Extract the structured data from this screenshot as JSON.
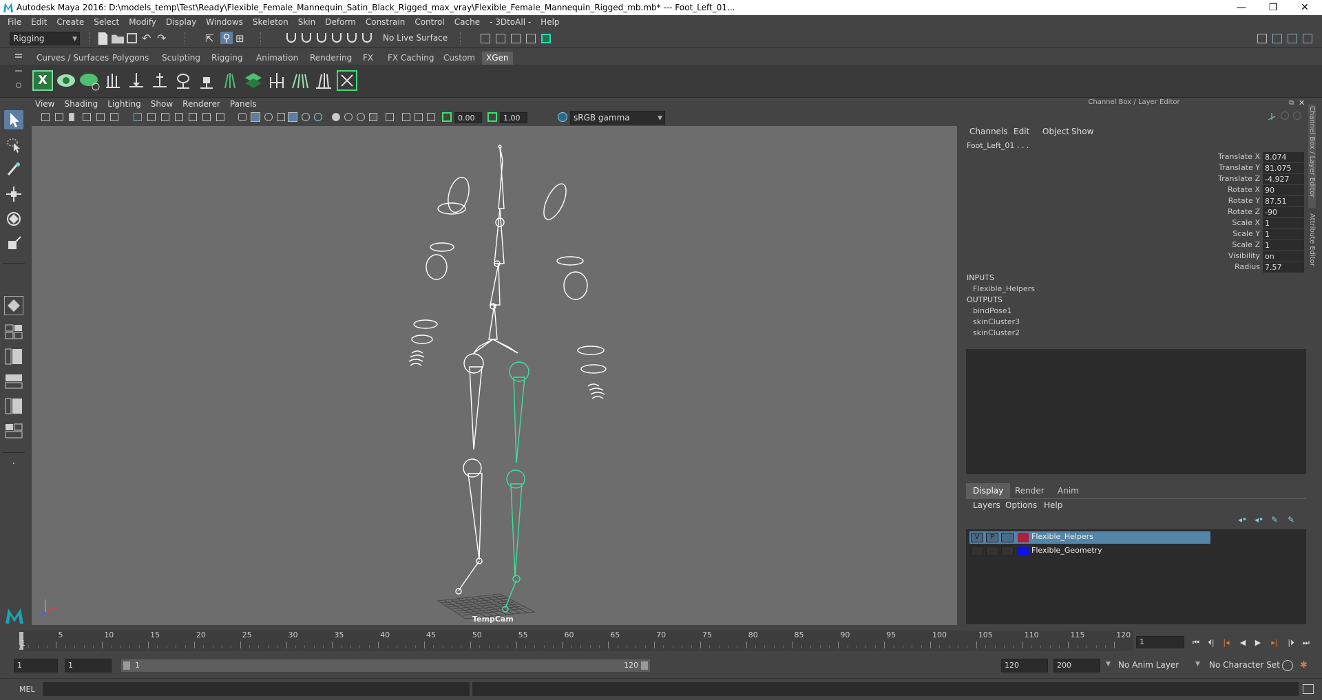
{
  "titlebar": {
    "title": "Autodesk Maya 2016: D:\\models_temp\\Test\\Ready\\Flexible_Female_Mannequin_Satin_Black_Rigged_max_vray\\Flexible_Female_Mannequin_Rigged_mb.mb*   ---   Foot_Left_01...",
    "minimize": "—",
    "maximize": "❐",
    "close": "✕"
  },
  "menubar": [
    "File",
    "Edit",
    "Create",
    "Select",
    "Modify",
    "Display",
    "Windows",
    "Skeleton",
    "Skin",
    "Deform",
    "Constrain",
    "Control",
    "Cache",
    "- 3DtoAll -",
    "Help"
  ],
  "statusline": {
    "menuset": "Rigging",
    "live_surface": "No Live Surface"
  },
  "shelf_tabs": [
    "Curves / Surfaces",
    "Polygons",
    "Sculpting",
    "Rigging",
    "Animation",
    "Rendering",
    "FX",
    "FX Caching",
    "Custom",
    "XGen"
  ],
  "shelf_active_tab": "XGen",
  "viewport": {
    "menu": [
      "View",
      "Shading",
      "Lighting",
      "Show",
      "Renderer",
      "Panels"
    ],
    "exposure": "0.00",
    "gamma": "1.00",
    "colorspace": "sRGB gamma",
    "camera_label": "TempCam",
    "axis_x": "x",
    "axis_y": "y"
  },
  "channel_box": {
    "header": "Channel Box / Layer Editor",
    "menu": [
      "Channels",
      "Edit",
      "Object",
      "Show"
    ],
    "object_name": "Foot_Left_01 . . .",
    "attributes": [
      {
        "label": "Translate X",
        "value": "8.074"
      },
      {
        "label": "Translate Y",
        "value": "81.075"
      },
      {
        "label": "Translate Z",
        "value": "-4.927"
      },
      {
        "label": "Rotate X",
        "value": "90"
      },
      {
        "label": "Rotate Y",
        "value": "87.51"
      },
      {
        "label": "Rotate Z",
        "value": "-90"
      },
      {
        "label": "Scale X",
        "value": "1"
      },
      {
        "label": "Scale Y",
        "value": "1"
      },
      {
        "label": "Scale Z",
        "value": "1"
      },
      {
        "label": "Visibility",
        "value": "on"
      },
      {
        "label": "Radius",
        "value": "7.57"
      }
    ],
    "inputs_label": "INPUTS",
    "inputs": [
      "Flexible_Helpers"
    ],
    "outputs_label": "OUTPUTS",
    "outputs": [
      "bindPose1",
      "skinCluster3",
      "skinCluster2"
    ]
  },
  "side_tabs": [
    "Channel Box / Layer Editor",
    "Attribute Editor"
  ],
  "layer_editor": {
    "tabs": [
      "Display",
      "Render",
      "Anim"
    ],
    "active_tab": "Display",
    "menu": [
      "Layers",
      "Options",
      "Help"
    ],
    "layers": [
      {
        "v": "V",
        "p": "P",
        "color": "#b01e3c",
        "name": "Flexible_Helpers",
        "selected": true
      },
      {
        "v": "",
        "p": "",
        "color": "#1010e8",
        "name": "Flexible_Geometry",
        "selected": false
      }
    ]
  },
  "timeline": {
    "ticks": [
      "5",
      "10",
      "15",
      "20",
      "25",
      "30",
      "35",
      "40",
      "45",
      "50",
      "55",
      "60",
      "65",
      "70",
      "75",
      "80",
      "85",
      "90",
      "95",
      "100",
      "105",
      "110",
      "115",
      "120"
    ],
    "start_label": "1",
    "current_frame": "1"
  },
  "range": {
    "start": "1",
    "start_inner": "1",
    "slider_start": "1",
    "slider_end": "120",
    "end_inner": "120",
    "end": "200",
    "anim_layer": "No Anim Layer",
    "character_set": "No Character Set"
  },
  "cmdline": {
    "label": "MEL"
  },
  "colors": {
    "bg": "#444444",
    "viewport": "#6d6d6d",
    "selected_layer": "#5285a6",
    "joint_selected": "#3fdfa0"
  }
}
